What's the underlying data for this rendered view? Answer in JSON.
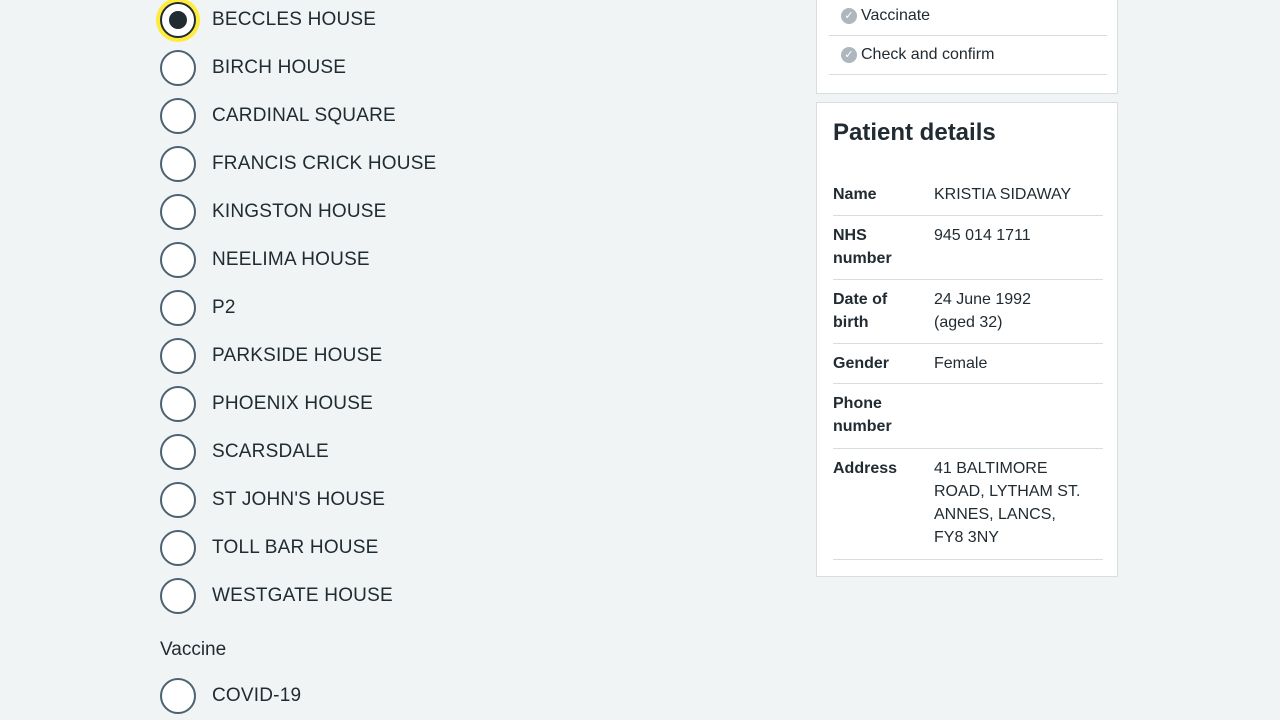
{
  "location_options": [
    {
      "label": "BECCLES HOUSE",
      "selected": true
    },
    {
      "label": "BIRCH HOUSE",
      "selected": false
    },
    {
      "label": "CARDINAL SQUARE",
      "selected": false
    },
    {
      "label": "FRANCIS CRICK HOUSE",
      "selected": false
    },
    {
      "label": "KINGSTON HOUSE",
      "selected": false
    },
    {
      "label": "NEELIMA HOUSE",
      "selected": false
    },
    {
      "label": "P2",
      "selected": false
    },
    {
      "label": "PARKSIDE HOUSE",
      "selected": false
    },
    {
      "label": "PHOENIX HOUSE",
      "selected": false
    },
    {
      "label": "SCARSDALE",
      "selected": false
    },
    {
      "label": "ST JOHN'S HOUSE",
      "selected": false
    },
    {
      "label": "TOLL BAR HOUSE",
      "selected": false
    },
    {
      "label": "WESTGATE HOUSE",
      "selected": false
    }
  ],
  "vaccine": {
    "label": "Vaccine",
    "options": [
      {
        "label": "COVID-19",
        "selected": false
      }
    ]
  },
  "steps": [
    {
      "label": "Vaccinate",
      "icon": "check-circle-icon"
    },
    {
      "label": "Check and confirm",
      "icon": "check-circle-icon"
    }
  ],
  "patient": {
    "title": "Patient details",
    "rows": [
      {
        "key": "Name",
        "value": "KRISTIA SIDAWAY"
      },
      {
        "key": "NHS number",
        "value": "945 014 1711"
      },
      {
        "key": "Date of birth",
        "value": "24 June 1992 (aged 32)"
      },
      {
        "key": "Gender",
        "value": "Female"
      },
      {
        "key": "Phone number",
        "value": ""
      },
      {
        "key": "Address",
        "value": "41 BALTIMORE ROAD, LYTHAM ST. ANNES, LANCS, FY8 3NY"
      }
    ]
  },
  "colors": {
    "background": "#f0f4f5",
    "text": "#212b32",
    "radio_border": "#4c6272",
    "focus": "#ffeb3b"
  }
}
